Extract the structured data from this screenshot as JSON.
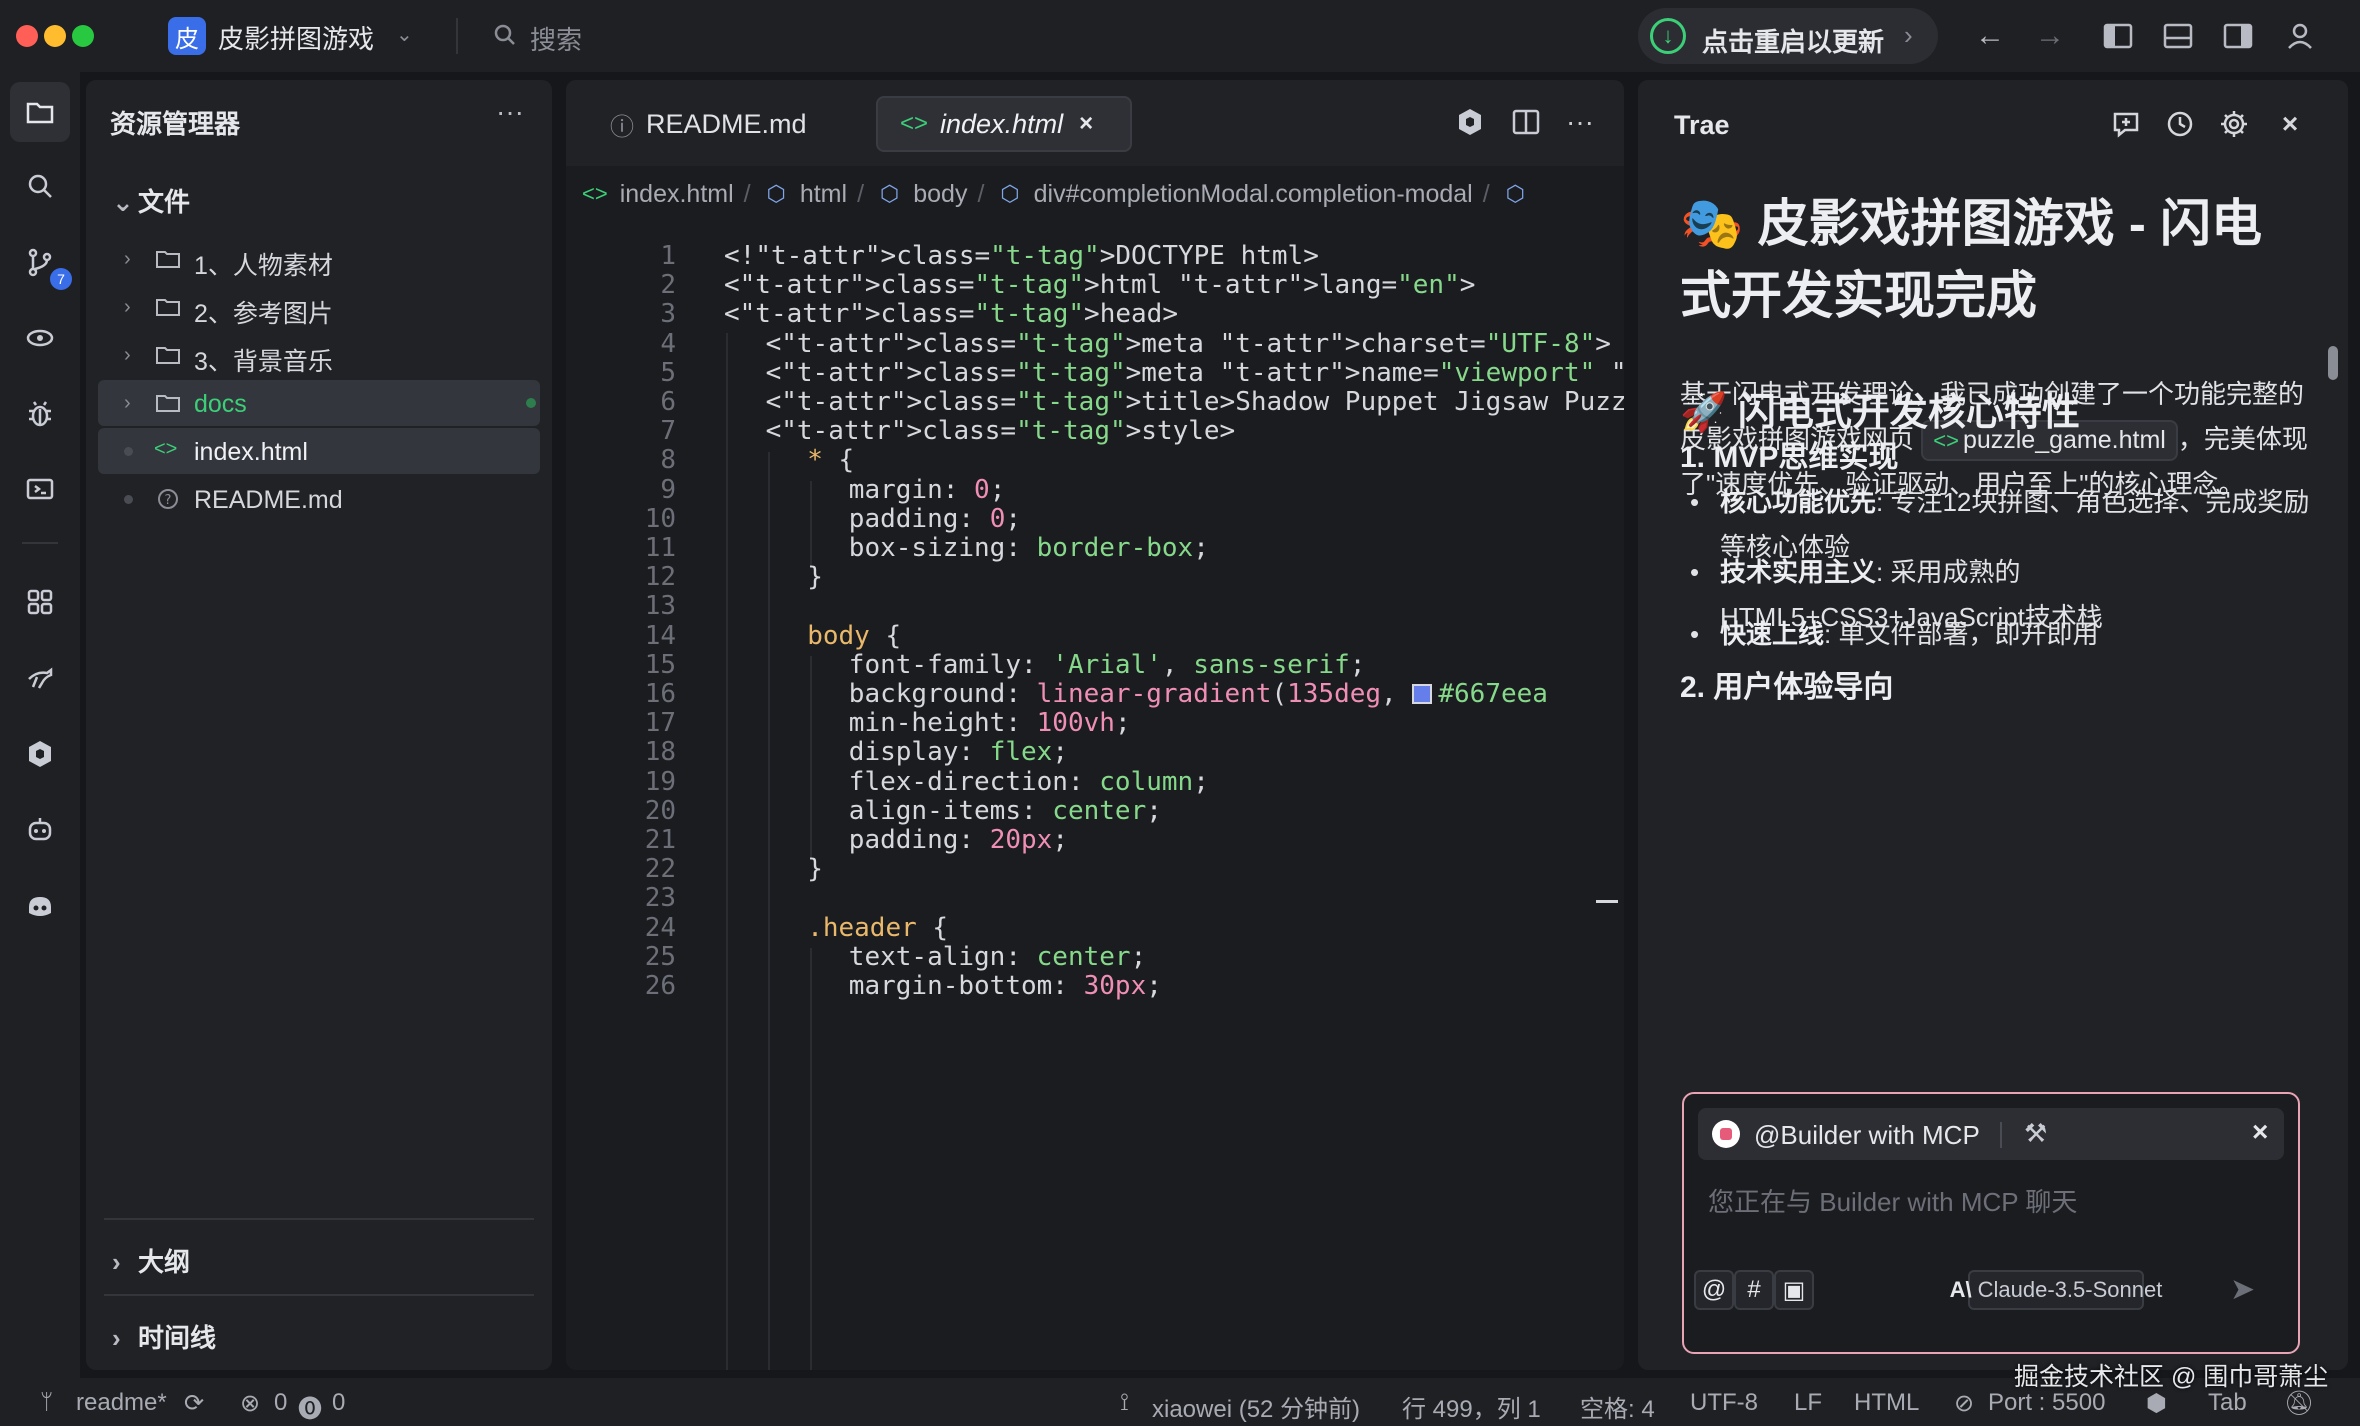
{
  "titlebar": {
    "project_badge": "皮",
    "project_name": "皮影拼图游戏",
    "search_placeholder": "搜索",
    "update_label": "点击重启以更新"
  },
  "activity": {
    "scm_badge": "7"
  },
  "explorer": {
    "title": "资源管理器",
    "files_section": "文件",
    "items": [
      {
        "label": "1、人物素材",
        "type": "folder"
      },
      {
        "label": "2、参考图片",
        "type": "folder"
      },
      {
        "label": "3、背景音乐",
        "type": "folder"
      },
      {
        "label": "docs",
        "type": "folder"
      },
      {
        "label": "index.html",
        "type": "html"
      },
      {
        "label": "README.md",
        "type": "md"
      }
    ],
    "outline_section": "大纲",
    "timeline_section": "时间线"
  },
  "editor": {
    "tabs": [
      {
        "label": "README.md",
        "active": false
      },
      {
        "label": "index.html",
        "active": true
      }
    ],
    "breadcrumb": [
      "index.html",
      "html",
      "body",
      "div#completionModal.completion-modal"
    ],
    "line_numbers": [
      "1",
      "2",
      "3",
      "4",
      "5",
      "6",
      "7",
      "8",
      "9",
      "10",
      "11",
      "12",
      "13",
      "14",
      "15",
      "16",
      "17",
      "18",
      "19",
      "20",
      "21",
      "22",
      "23",
      "24",
      "25",
      "26"
    ],
    "code": [
      "<!DOCTYPE html>",
      "<html lang=\"en\">",
      "<head>",
      "<meta charset=\"UTF-8\">",
      "<meta name=\"viewport\" content=\"width=device-width, in",
      "<title>Shadow Puppet Jigsaw Puzzle | 皮影拼图游戏</tit",
      "<style>",
      "* {",
      "margin: 0;",
      "padding: 0;",
      "box-sizing: border-box;",
      "}",
      "",
      "body {",
      "font-family: 'Arial', sans-serif;",
      "background: linear-gradient(135deg, #667eea",
      "min-height: 100vh;",
      "display: flex;",
      "flex-direction: column;",
      "align-items: center;",
      "padding: 20px;",
      "}",
      "",
      ".header {",
      "text-align: center;",
      "margin-bottom: 30px;"
    ],
    "swatch_color": "#667eea"
  },
  "chat": {
    "title": "Trae",
    "heading": "🎭 皮影戏拼图游戏 - 闪电式开发实现完成",
    "intro_1": "基于闪电式开发理论，我已成功创建了一个功能完整的皮影戏拼图游戏网页 ",
    "intro_code": "puzzle_game.html",
    "intro_2": "，完美体现了\"速度优先、验证驱动、用户至上\"的核心理念。",
    "section_title": "🚀 闪电式开发核心特性",
    "sub1": "1. MVP思维实现",
    "bullets": [
      {
        "bold": "核心功能优先",
        "text": ": 专注12块拼图、角色选择、完成奖励等核心体验"
      },
      {
        "bold": "技术实用主义",
        "text": ": 采用成熟的HTML5+CSS3+JavaScript技术栈"
      },
      {
        "bold": "快速上线",
        "text": ": 单文件部署，即开即用"
      }
    ],
    "sub2": "2. 用户体验导向",
    "input": {
      "agent": "@Builder with MCP",
      "placeholder": "您正在与 Builder with MCP 聊天",
      "model": "Claude-3.5-Sonnet"
    }
  },
  "statusbar": {
    "branch": "readme*",
    "errors": "0",
    "warnings": "0",
    "author": "xiaowei (52 分钟前)",
    "position": "行 499，列 1",
    "spaces": "空格: 4",
    "encoding": "UTF-8",
    "eol": "LF",
    "language": "HTML",
    "port": "Port : 5500",
    "tab": "Tab"
  },
  "watermark": "掘金技术社区 @ 围巾哥萧尘"
}
